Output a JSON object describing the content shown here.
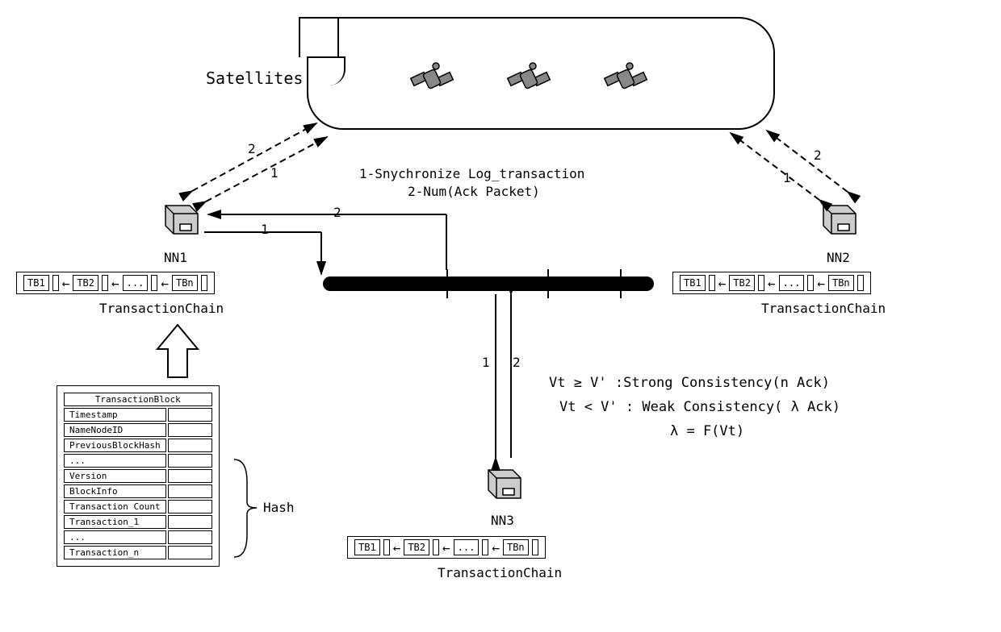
{
  "satellites_label": "Satellites",
  "sync_text_1": "1-Snychronize Log_transaction",
  "sync_text_2": "2-Num(Ack Packet)",
  "nodes": {
    "nn1": "NN1",
    "nn2": "NN2",
    "nn3": "NN3"
  },
  "chain_label": "TransactionChain",
  "blocks": {
    "tb1": "TB1",
    "tb2": "TB2",
    "dots": "...",
    "tbn": "TBn"
  },
  "tblock": {
    "title": "TransactionBlock",
    "rows": [
      "Timestamp",
      "NameNodeID",
      "PreviousBlockHash",
      "...",
      "Version",
      "BlockInfo",
      "Transaction Count",
      "Transaction_1",
      "...",
      "Transaction_n"
    ]
  },
  "hash_label": "Hash",
  "consistency": {
    "line1": "Vt ≥ V' :Strong Consistency(n Ack)",
    "line2": "Vt < V' : Weak Consistency( λ Ack)",
    "line3": "λ = F(Vt)"
  },
  "edge_labels": {
    "one": "1",
    "two": "2"
  }
}
